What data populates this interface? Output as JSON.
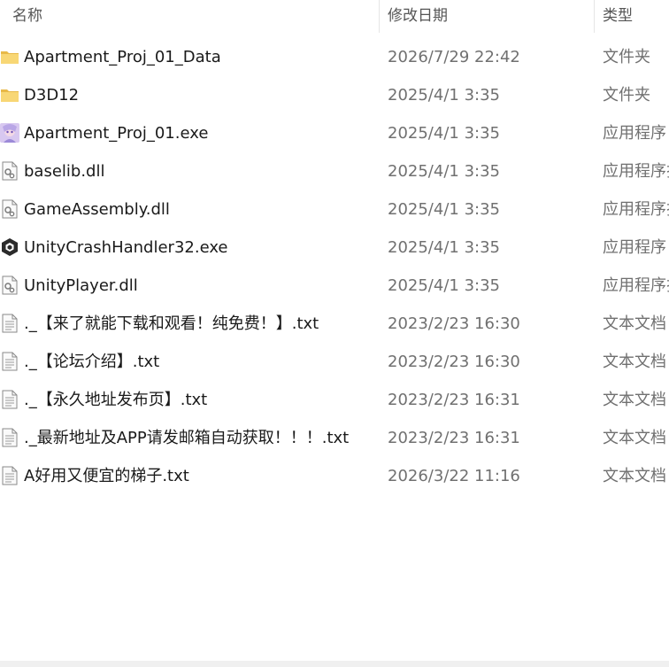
{
  "columns": {
    "name": "名称",
    "date_modified": "修改日期",
    "type": "类型"
  },
  "files": [
    {
      "name": "Apartment_Proj_01_Data",
      "date": "2026/7/29 22:42",
      "type": "文件夹",
      "icon": "folder-icon"
    },
    {
      "name": "D3D12",
      "date": "2025/4/1 3:35",
      "type": "文件夹",
      "icon": "folder-icon"
    },
    {
      "name": "Apartment_Proj_01.exe",
      "date": "2025/4/1 3:35",
      "type": "应用程序",
      "icon": "app-exe-icon"
    },
    {
      "name": "baselib.dll",
      "date": "2025/4/1 3:35",
      "type": "应用程序扩",
      "icon": "dll-file-icon"
    },
    {
      "name": "GameAssembly.dll",
      "date": "2025/4/1 3:35",
      "type": "应用程序扩",
      "icon": "dll-file-icon"
    },
    {
      "name": "UnityCrashHandler32.exe",
      "date": "2025/4/1 3:35",
      "type": "应用程序",
      "icon": "unity-icon"
    },
    {
      "name": "UnityPlayer.dll",
      "date": "2025/4/1 3:35",
      "type": "应用程序扩",
      "icon": "dll-file-icon"
    },
    {
      "name": "._【来了就能下载和观看！纯免费！】.txt",
      "date": "2023/2/23 16:30",
      "type": "文本文档",
      "icon": "text-file-icon"
    },
    {
      "name": "._【论坛介绍】.txt",
      "date": "2023/2/23 16:30",
      "type": "文本文档",
      "icon": "text-file-icon"
    },
    {
      "name": "._【永久地址发布页】.txt",
      "date": "2023/2/23 16:31",
      "type": "文本文档",
      "icon": "text-file-icon"
    },
    {
      "name": "._最新地址及APP请发邮箱自动获取！！！.txt",
      "date": "2023/2/23 16:31",
      "type": "文本文档",
      "icon": "text-file-icon"
    },
    {
      "name": "A好用又便宜的梯子.txt",
      "date": "2026/3/22 11:16",
      "type": "文本文档",
      "icon": "text-file-icon"
    }
  ]
}
